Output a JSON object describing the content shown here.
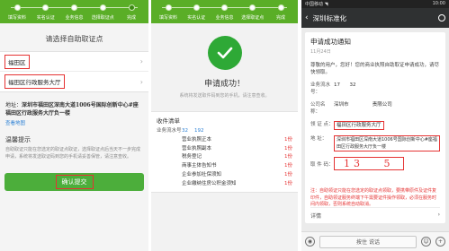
{
  "colors": {
    "green": "#5aae27",
    "button_green": "#4cae3b",
    "success_green": "#2ea936",
    "highlight_red": "#e53333",
    "link_blue": "#2a7fd4"
  },
  "panel1": {
    "steps": [
      "填写资料",
      "实名认证",
      "业务信息",
      "选择取证点",
      "完成"
    ],
    "title": "请选择自助取证点",
    "district": "福田区",
    "service_hall": "福田区行政服务大厅",
    "address_label": "地址：",
    "address_value": "深圳市福田区深南大道1006号国际创新中心#座 福田区行政服务大厅负一楼",
    "map_link": "查看地图",
    "tips_title": "温馨提示",
    "tips_text": "自助取证只能在您选定的取证点取证，选择取证点后当天不一步完成申请，系统将发送取证码到您的手机请妥善保管，请注意查收。",
    "confirm_button": "确认提交"
  },
  "panel2": {
    "success_icon": "checkmark-icon",
    "success_title": "申请成功！",
    "success_sub": "系统将发送取件码到您的手机，请注意查收。",
    "list_title": "收件清单",
    "business_no_label": "业务流水号",
    "business_no_a": "32",
    "business_no_b": "192",
    "items": [
      {
        "name": "营业执照正本",
        "count": "1份"
      },
      {
        "name": "营业执照副本",
        "count": "1份"
      },
      {
        "name": "税务登记",
        "count": "1份"
      },
      {
        "name": "商事主体告知书",
        "count": "1份"
      },
      {
        "name": "企业参加社保须知",
        "count": "1份"
      },
      {
        "name": "企业缴纳住房公积金须知",
        "count": "1份"
      }
    ]
  },
  "panel3": {
    "status_left": "中国移动 ◥",
    "status_right": "10:00",
    "back_icon": "chevron-left-icon",
    "title": "深圳标准化",
    "user_icon": "user-icon",
    "card_title": "申请成功通知",
    "card_date": "11月24日",
    "greeting": "尊敬的用户，您好！您的商业执照自助取证申请成功，请尽快领取。",
    "business_no_label": "业务流水号：",
    "business_no_value": "17      32",
    "company_label": "公司名称：",
    "company_value": "深圳市               责限公司",
    "pickup_label": "领 证 点：",
    "pickup_value": "福田区行政服务大厅",
    "address_label": "地   址：",
    "address_value": "深圳市福田区深南大道1006号国际创新中心#座福田区行政服务大厅负一楼",
    "code_label": "取 件 码：",
    "code_value": "13   5",
    "note": "注：自助领证只能在您选定的取证点领取，要携带原件及证件复印件，自助领证服务终端下午需要证件操作领取，必须在服务时间内领取，否则系统自动取消。",
    "detail_link": "详情",
    "talk_button": "按住 说话",
    "voice_icon": "voice-icon",
    "emoji_icon": "emoji-icon",
    "plus_icon": "plus-icon"
  }
}
